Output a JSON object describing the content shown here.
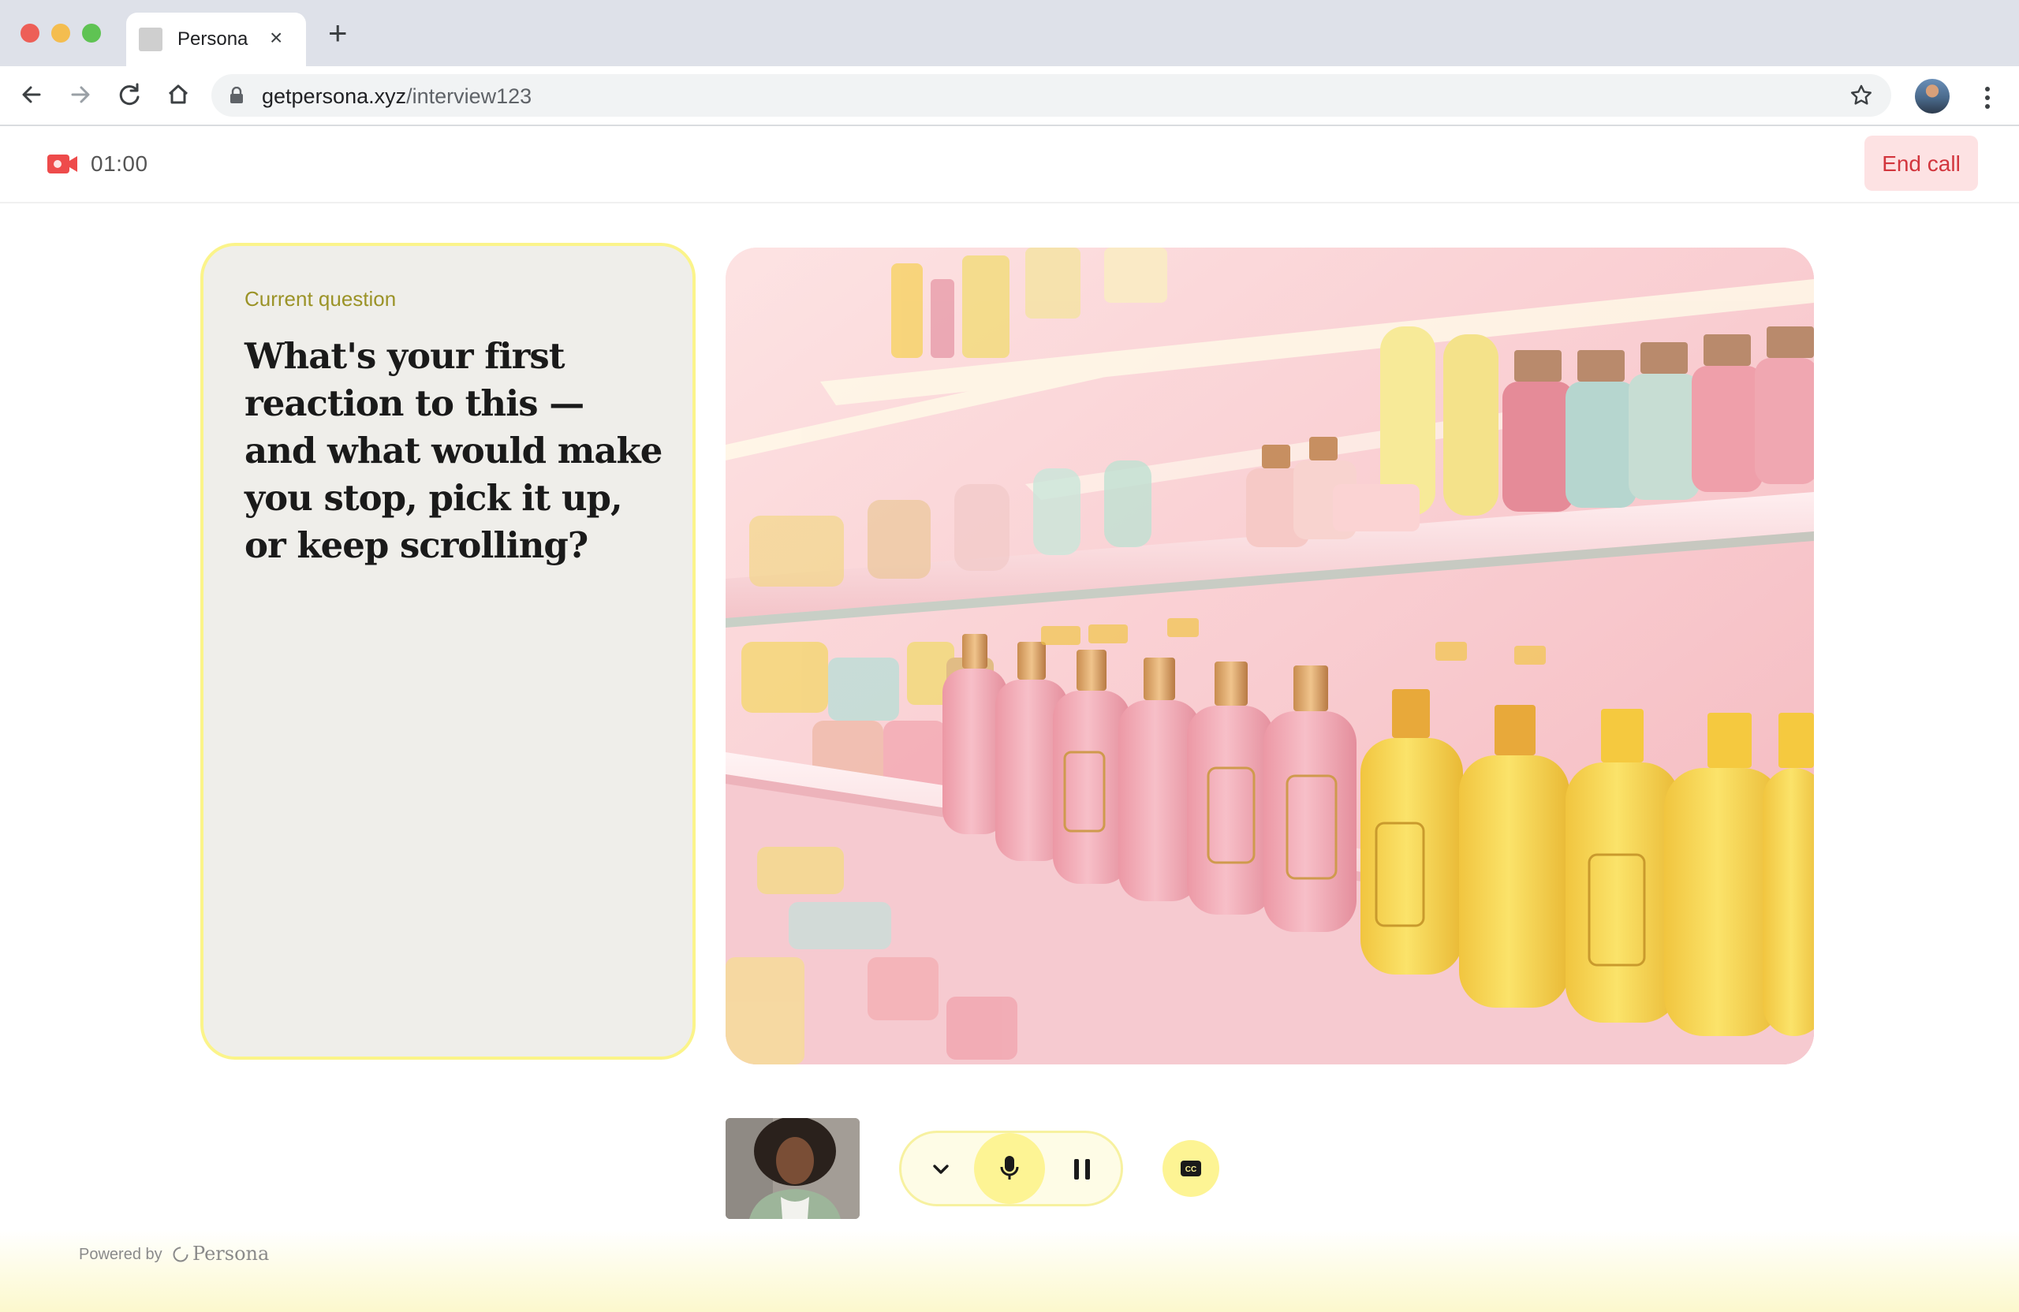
{
  "browser": {
    "tab_title": "Persona",
    "tab_close_label": "×",
    "new_tab_label": "+",
    "url_host": "getpersona.xyz",
    "url_path": "/interview123"
  },
  "header": {
    "timer": "01:00",
    "end_call_label": "End call"
  },
  "question": {
    "label": "Current question",
    "text": "What's your first reaction to this — and what would make you stop, pick it up, or keep scrolling?"
  },
  "controls": {
    "icons": [
      "chevron-down-icon",
      "microphone-icon",
      "pause-icon",
      "closed-captions-icon"
    ]
  },
  "footer": {
    "powered_by": "Powered by",
    "brand": "Persona"
  },
  "colors": {
    "accent_yellow": "#fdf494",
    "end_call_bg": "#fde2e3",
    "end_call_text": "#d2353d",
    "question_label": "#9b9327"
  }
}
